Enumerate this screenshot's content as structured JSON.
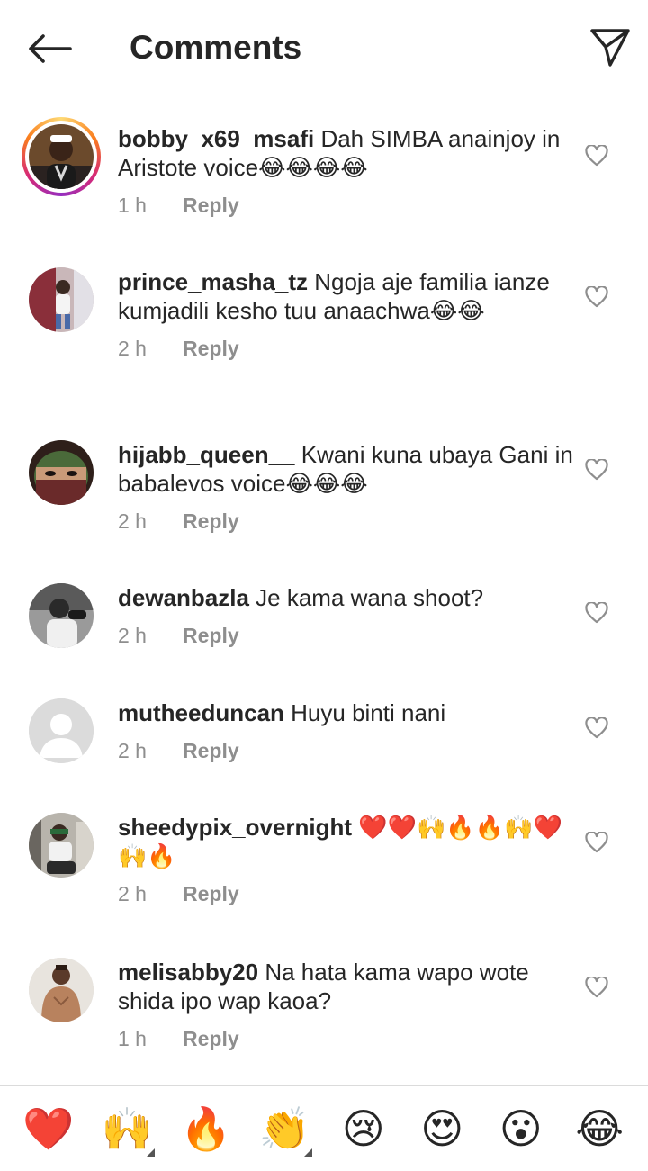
{
  "header": {
    "title": "Comments"
  },
  "comments": [
    {
      "username": "bobby_x69_msafi",
      "text": " Dah SIMBA anainjoy in Aristote voice😂😂😂😂",
      "time": "1 h",
      "reply": "Reply"
    },
    {
      "username": "prince_masha_tz",
      "text": " Ngoja aje familia ianze kumjadili kesho tuu anaachwa😂😂",
      "time": "2 h",
      "reply": "Reply"
    },
    {
      "username": "hijabb_queen__",
      "text": " Kwani kuna ubaya Gani in babalevos voice😂😂😂",
      "time": "2 h",
      "reply": "Reply"
    },
    {
      "username": "dewanbazla",
      "text": " Je kama wana shoot?",
      "time": "2 h",
      "reply": "Reply"
    },
    {
      "username": "mutheeduncan",
      "text": " Huyu binti nani",
      "time": "2 h",
      "reply": "Reply"
    },
    {
      "username": "sheedypix_overnight",
      "text": " ❤️❤️🙌🔥🔥🙌❤️🙌🔥",
      "time": "2 h",
      "reply": "Reply"
    },
    {
      "username": "melisabby20",
      "text": " Na hata kama wapo wote shida ipo wap kaoa?",
      "time": "1 h",
      "reply": "Reply"
    }
  ],
  "emoji_bar": [
    "❤️",
    "🙌",
    "🔥",
    "👏",
    "😢",
    "😍",
    "😮",
    "😂"
  ],
  "icons": {
    "back": "arrow-left-icon",
    "send": "paper-plane-icon",
    "like": "heart-outline-icon"
  },
  "colors": {
    "text": "#262626",
    "meta": "#8e8e8e",
    "divider": "#dbdbdb"
  }
}
